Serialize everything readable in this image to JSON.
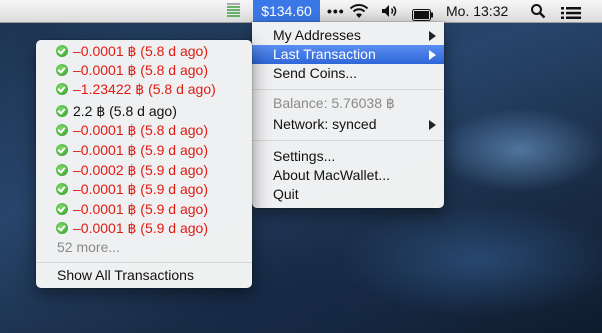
{
  "menubar": {
    "price": "$134.60",
    "dots": "•••",
    "clock": "Mo. 13:32",
    "icons": [
      "battery-meter-icon",
      "wifi-icon",
      "volume-icon",
      "battery-icon",
      "spotlight-search-icon",
      "notification-list-icon"
    ]
  },
  "main_menu": {
    "items": [
      {
        "label": "My Addresses",
        "has_submenu": true
      },
      {
        "label": "Last Transaction",
        "has_submenu": true,
        "highlighted": true
      },
      {
        "label": "Send Coins..."
      },
      {
        "label": "Balance: 5.76038 ฿",
        "disabled": true
      },
      {
        "label": "Network: synced",
        "has_submenu": true
      },
      {
        "label": "Settings..."
      },
      {
        "label": "About MacWallet..."
      },
      {
        "label": "Quit"
      }
    ]
  },
  "transactions": {
    "items": [
      {
        "amount": "–0.0001 ฿ (5.8 d ago)",
        "negative": true
      },
      {
        "amount": "–0.0001 ฿ (5.8 d ago)",
        "negative": true
      },
      {
        "amount": "–1.23422 ฿ (5.8 d ago)",
        "negative": true
      },
      {
        "amount": "2.2 ฿ (5.8 d ago)",
        "negative": false
      },
      {
        "amount": "–0.0001 ฿ (5.8 d ago)",
        "negative": true
      },
      {
        "amount": "–0.0001 ฿ (5.9 d ago)",
        "negative": true
      },
      {
        "amount": "–0.0002 ฿ (5.9 d ago)",
        "negative": true
      },
      {
        "amount": "–0.0001 ฿ (5.9 d ago)",
        "negative": true
      },
      {
        "amount": "–0.0001 ฿ (5.9 d ago)",
        "negative": true
      },
      {
        "amount": "–0.0001 ฿ (5.9 d ago)",
        "negative": true
      }
    ],
    "more": "52 more...",
    "show_all": "Show All Transactions"
  },
  "colors": {
    "negative": "#e01b12",
    "highlight": "#3b78e7",
    "confirmed_check": "#2f9a26"
  }
}
